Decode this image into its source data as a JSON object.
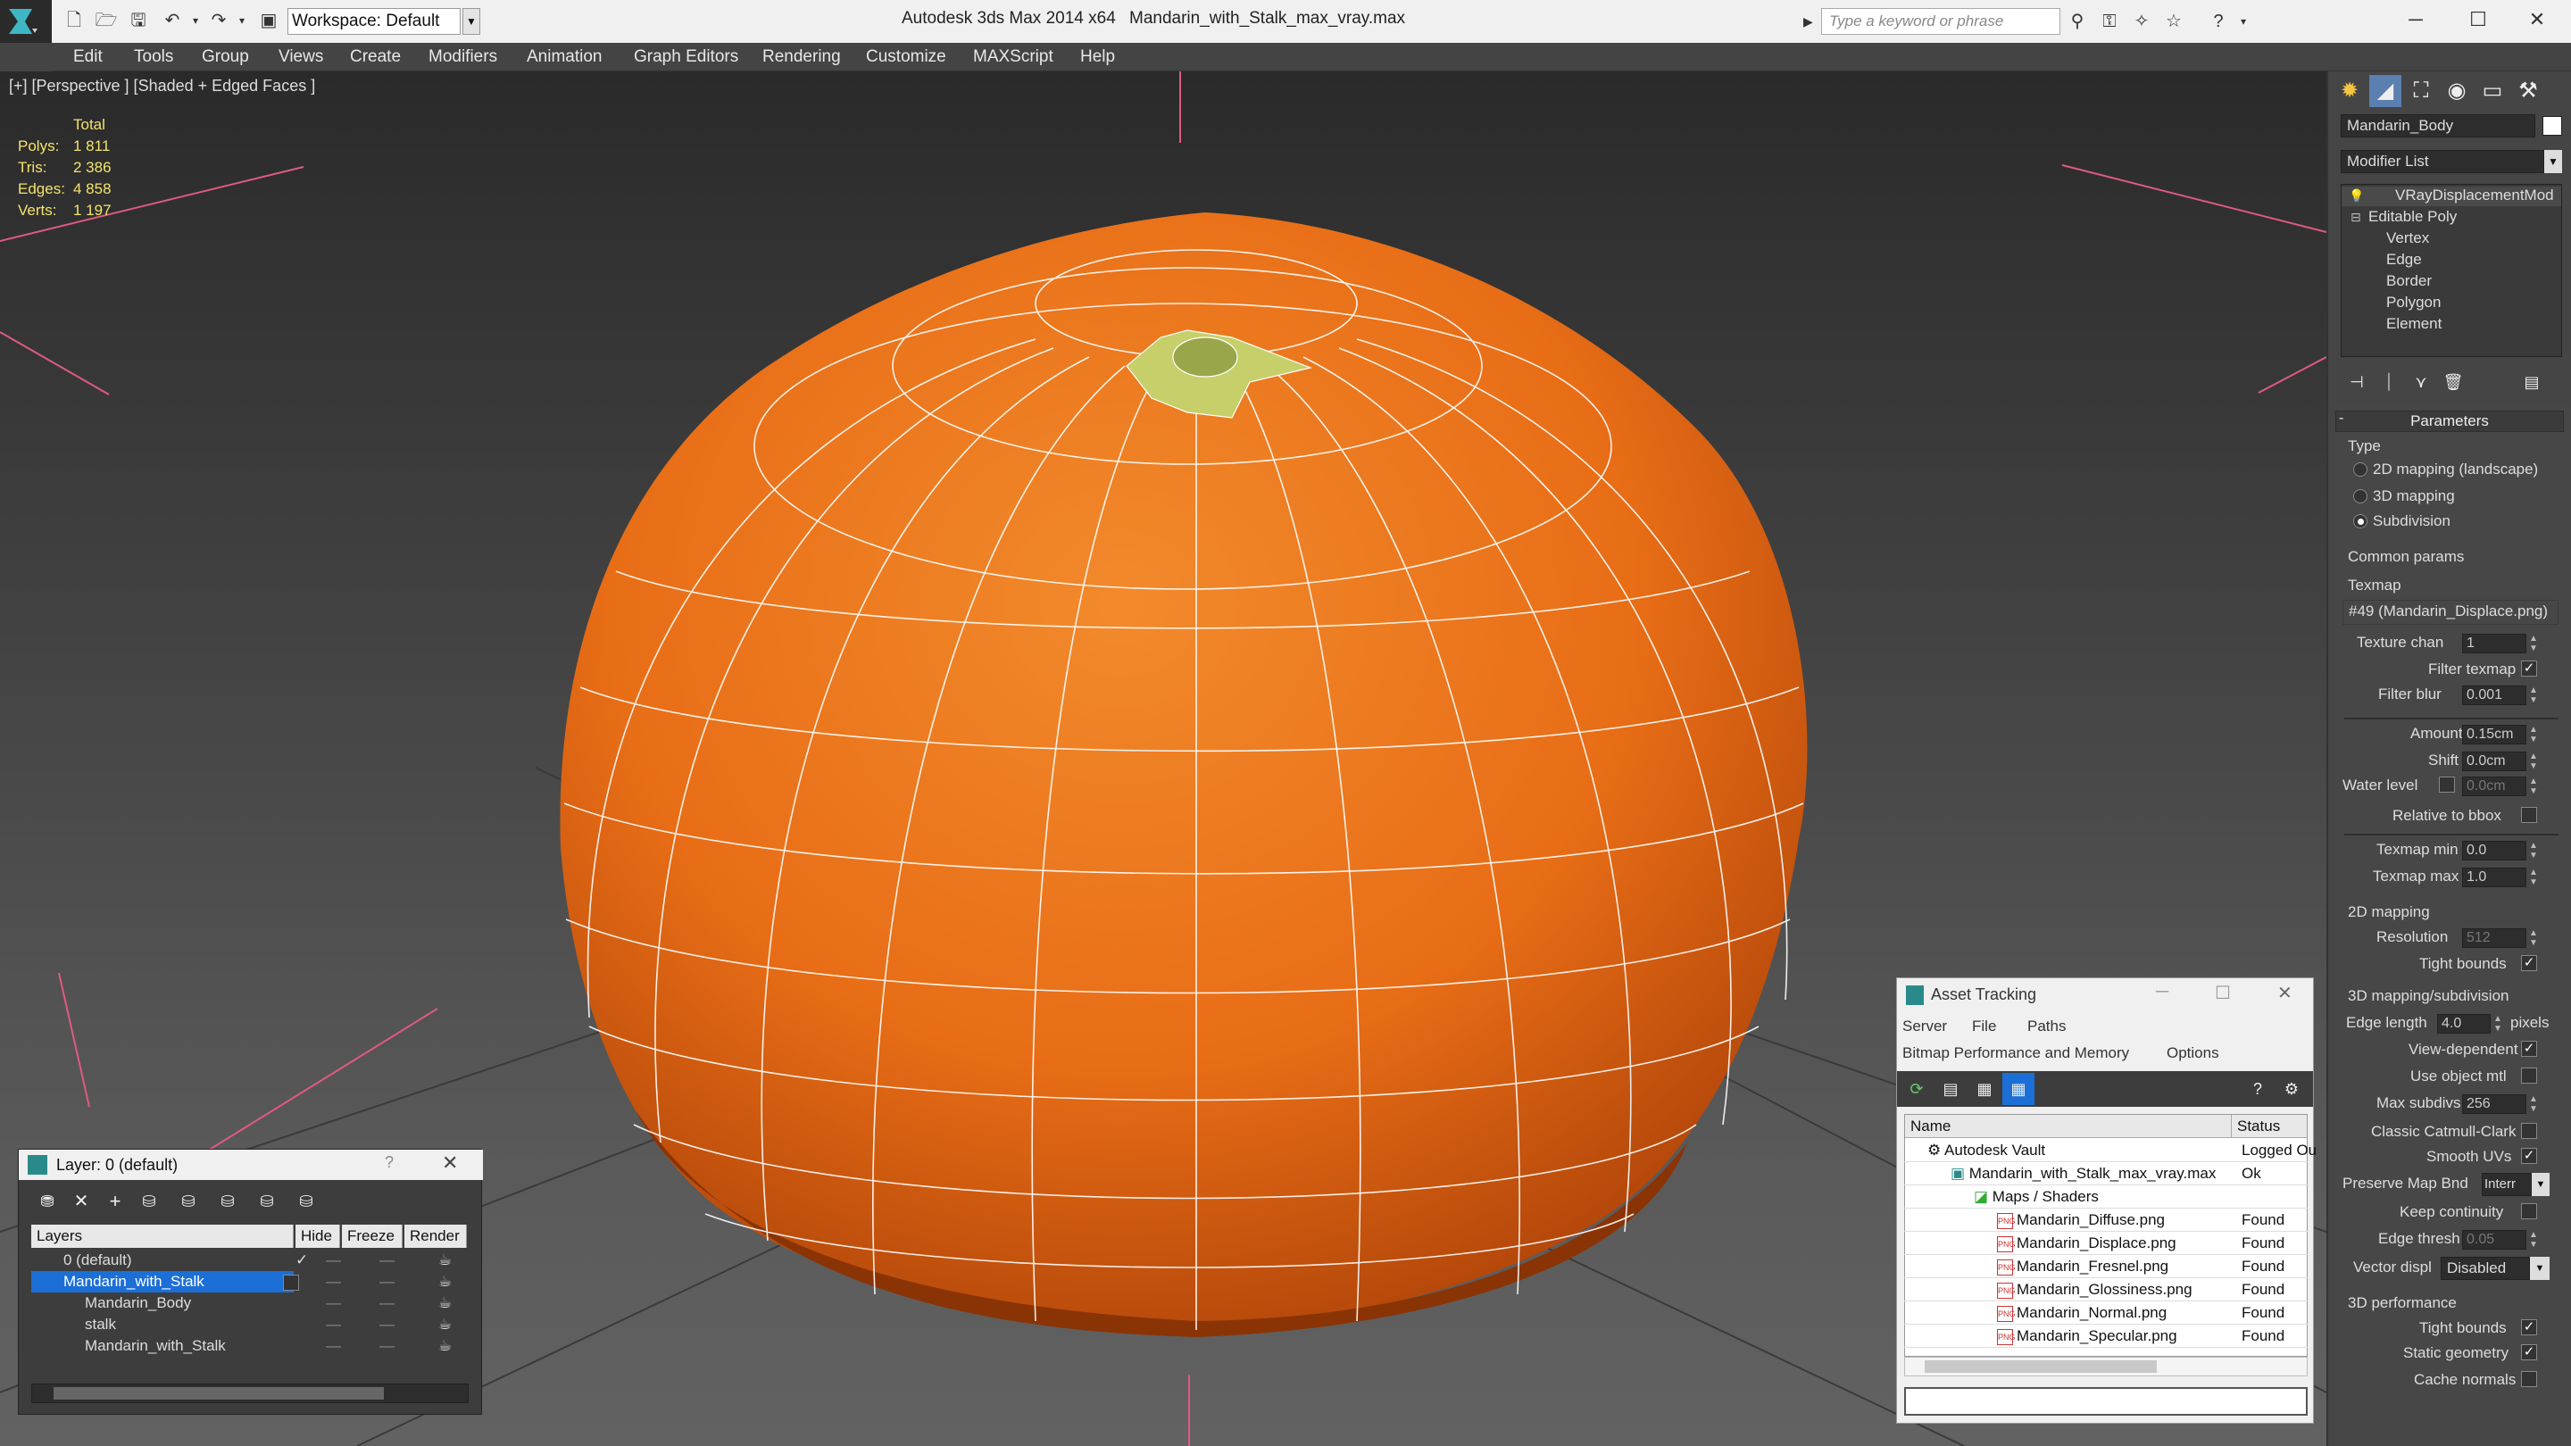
{
  "titlebar": {
    "workspace": "Workspace: Default",
    "app_title": "Autodesk 3ds Max  2014 x64",
    "doc_title": "Mandarin_with_Stalk_max_vray.max",
    "search_placeholder": "Type a keyword or phrase"
  },
  "menu": [
    "Edit",
    "Tools",
    "Group",
    "Views",
    "Create",
    "Modifiers",
    "Animation",
    "Graph Editors",
    "Rendering",
    "Customize",
    "MAXScript",
    "Help"
  ],
  "viewport": {
    "label": "[+] [Perspective ] [Shaded + Edged Faces ]",
    "stats": {
      "header": "Total",
      "rows": [
        {
          "label": "Polys:",
          "value": "1 811"
        },
        {
          "label": "Tris:",
          "value": "2 386"
        },
        {
          "label": "Edges:",
          "value": "4 858"
        },
        {
          "label": "Verts:",
          "value": "1 197"
        }
      ]
    }
  },
  "command_panel": {
    "object_name": "Mandarin_Body",
    "modifier_list": "Modifier List",
    "stack": [
      "VRayDisplacementMod",
      "Editable Poly",
      "Vertex",
      "Edge",
      "Border",
      "Polygon",
      "Element"
    ],
    "parameters": {
      "title": "Parameters",
      "type_label": "Type",
      "types": [
        "2D mapping (landscape)",
        "3D mapping",
        "Subdivision"
      ],
      "selected_type": 2,
      "common_params": "Common params",
      "texmap_label": "Texmap",
      "texmap_value": "#49 (Mandarin_Displace.png)",
      "texture_chan": {
        "label": "Texture chan",
        "value": "1"
      },
      "filter_texmap": {
        "label": "Filter texmap",
        "checked": "✓"
      },
      "filter_blur": {
        "label": "Filter blur",
        "value": "0.001"
      },
      "amount": {
        "label": "Amount",
        "value": "0.15cm"
      },
      "shift": {
        "label": "Shift",
        "value": "0.0cm"
      },
      "water_level": {
        "label": "Water level",
        "value": "0.0cm"
      },
      "relative_bbox": "Relative to bbox",
      "texmap_min": {
        "label": "Texmap min",
        "value": "0.0"
      },
      "texmap_max": {
        "label": "Texmap max",
        "value": "1.0"
      },
      "mapping_2d": "2D mapping",
      "resolution": {
        "label": "Resolution",
        "value": "512"
      },
      "tight_bounds": "Tight bounds",
      "mapping_3d": "3D mapping/subdivision",
      "edge_length": {
        "label": "Edge length",
        "value": "4.0",
        "unit": "pixels"
      },
      "view_dependent": "View-dependent",
      "use_object_mtl": "Use object mtl",
      "max_subdivs": {
        "label": "Max subdivs",
        "value": "256"
      },
      "classic_catmull": "Classic Catmull-Clark",
      "smooth_uvs": "Smooth UVs",
      "preserve_map_bnd": {
        "label": "Preserve Map Bnd",
        "value": "Interr"
      },
      "keep_continuity": "Keep continuity",
      "edge_thresh": {
        "label": "Edge thresh",
        "value": "0.05"
      },
      "vector_displ": {
        "label": "Vector displ",
        "value": "Disabled"
      },
      "performance_3d": "3D performance",
      "tight_bounds_2": "Tight bounds",
      "static_geometry": "Static geometry",
      "cache_normals": "Cache normals"
    }
  },
  "layer_panel": {
    "title": "Layer: 0 (default)",
    "columns": [
      "Layers",
      "Hide",
      "Freeze",
      "Render"
    ],
    "rows": [
      "0 (default)",
      "Mandarin_with_Stalk",
      "Mandarin_Body",
      "stalk",
      "Mandarin_with_Stalk"
    ]
  },
  "asset_panel": {
    "title": "Asset Tracking",
    "menu": [
      "Server",
      "File",
      "Paths"
    ],
    "menu2": [
      "Bitmap Performance and Memory",
      "Options"
    ],
    "columns": [
      "Name",
      "Status"
    ],
    "rows": [
      {
        "name": "Autodesk Vault",
        "status": "Logged Ou"
      },
      {
        "name": "Mandarin_with_Stalk_max_vray.max",
        "status": "Ok"
      },
      {
        "name": "Maps / Shaders",
        "status": ""
      },
      {
        "name": "Mandarin_Diffuse.png",
        "status": "Found"
      },
      {
        "name": "Mandarin_Displace.png",
        "status": "Found"
      },
      {
        "name": "Mandarin_Fresnel.png",
        "status": "Found"
      },
      {
        "name": "Mandarin_Glossiness.png",
        "status": "Found"
      },
      {
        "name": "Mandarin_Normal.png",
        "status": "Found"
      },
      {
        "name": "Mandarin_Specular.png",
        "status": "Found"
      }
    ]
  },
  "colors": {
    "accent": "#1b6fd6",
    "mandarin": "#e8701c",
    "stats": "#f4e36a"
  }
}
